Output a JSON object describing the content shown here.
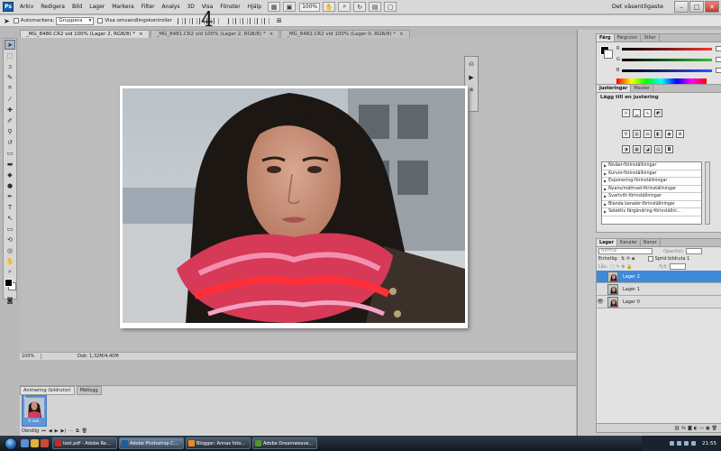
{
  "app": {
    "logo": "Ps",
    "menu": [
      "Arkiv",
      "Redigera",
      "Bild",
      "Lager",
      "Markera",
      "Filter",
      "Analys",
      "3D",
      "Visa",
      "Fönster",
      "Hjälp"
    ],
    "zoom_level": "100%",
    "workspace": "Det väsentligaste"
  },
  "options_bar": {
    "auto_select_label": "Automarkera:",
    "auto_select_value": "Gruppera",
    "show_transform_label": "Visa omvandlingskontroller"
  },
  "annotations": {
    "n3": "3",
    "n4": "4",
    "n5": "5"
  },
  "tabs": [
    {
      "label": "_MG_8480.CR2 vid 100% (Lager 2, RGB/8) *"
    },
    {
      "label": "_MG_8481.CR2 vid 100% (Lager 2, RGB/8) *"
    },
    {
      "label": "_MG_8482.CR2 vid 100% (Lager 0, RGB/8) *"
    }
  ],
  "status": {
    "zoom": "100%",
    "docsize": "Dok: 1,32M/4,40M"
  },
  "animation": {
    "tabs": [
      "Animering (bildrutor)",
      "Mätlogg"
    ],
    "frame_number": "1",
    "frame_time": "0 sek.",
    "loop": "Oändlig"
  },
  "color_panel": {
    "tabs": [
      "Färg",
      "Färgrutor",
      "Stilar"
    ],
    "channels": [
      {
        "label": "R",
        "color": "#ff3030"
      },
      {
        "label": "G",
        "color": "#30c030"
      },
      {
        "label": "B",
        "color": "#3050ff"
      }
    ]
  },
  "adjustments": {
    "tabs": [
      "Justeringar",
      "Masker"
    ],
    "title": "Lägg till en justering",
    "presets": [
      "Nivåer-förinställningar",
      "Kurvor-förinställningar",
      "Exponering-förinställningar",
      "Nyans/mättnad-förinställningar",
      "Svartvitt-förinställningar",
      "Blanda kanaler-förinställningar",
      "Selektiv färgändring-förinställni..."
    ]
  },
  "layers": {
    "tabs": [
      "Lager",
      "Kanaler",
      "Banor"
    ],
    "blend_mode": "Normal",
    "opacity_label": "Opacitet:",
    "unify_label": "Enhetlig:",
    "propagate_label": "Sprid bildruta 1",
    "lock_label": "Lås:",
    "fill_label": "Fyll:",
    "items": [
      {
        "name": "Lager 2",
        "selected": true,
        "visible": false
      },
      {
        "name": "Lager 1",
        "selected": false,
        "visible": false
      },
      {
        "name": "Lager 0",
        "selected": false,
        "visible": true
      }
    ]
  },
  "taskbar": {
    "tasks": [
      {
        "label": "test.pdf - Adobe Re...",
        "icon_color": "#c8282a",
        "active": false
      },
      {
        "label": "Adobe Photoshop C...",
        "icon_color": "#1b5ea8",
        "active": true
      },
      {
        "label": "Blogger: Annas foto...",
        "icon_color": "#f08a1c",
        "active": false
      },
      {
        "label": "Adobe Dreamweave...",
        "icon_color": "#4d9a2a",
        "active": false
      }
    ],
    "clock": "21:55"
  }
}
